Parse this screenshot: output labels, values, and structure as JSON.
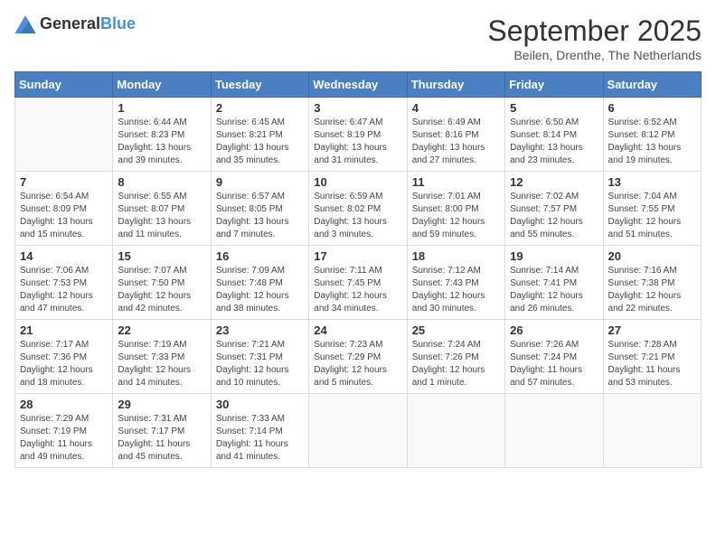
{
  "header": {
    "logo_general": "General",
    "logo_blue": "Blue",
    "month": "September 2025",
    "location": "Beilen, Drenthe, The Netherlands"
  },
  "weekdays": [
    "Sunday",
    "Monday",
    "Tuesday",
    "Wednesday",
    "Thursday",
    "Friday",
    "Saturday"
  ],
  "weeks": [
    [
      {
        "day": "",
        "info": ""
      },
      {
        "day": "1",
        "info": "Sunrise: 6:44 AM\nSunset: 8:23 PM\nDaylight: 13 hours\nand 39 minutes."
      },
      {
        "day": "2",
        "info": "Sunrise: 6:45 AM\nSunset: 8:21 PM\nDaylight: 13 hours\nand 35 minutes."
      },
      {
        "day": "3",
        "info": "Sunrise: 6:47 AM\nSunset: 8:19 PM\nDaylight: 13 hours\nand 31 minutes."
      },
      {
        "day": "4",
        "info": "Sunrise: 6:49 AM\nSunset: 8:16 PM\nDaylight: 13 hours\nand 27 minutes."
      },
      {
        "day": "5",
        "info": "Sunrise: 6:50 AM\nSunset: 8:14 PM\nDaylight: 13 hours\nand 23 minutes."
      },
      {
        "day": "6",
        "info": "Sunrise: 6:52 AM\nSunset: 8:12 PM\nDaylight: 13 hours\nand 19 minutes."
      }
    ],
    [
      {
        "day": "7",
        "info": "Sunrise: 6:54 AM\nSunset: 8:09 PM\nDaylight: 13 hours\nand 15 minutes."
      },
      {
        "day": "8",
        "info": "Sunrise: 6:55 AM\nSunset: 8:07 PM\nDaylight: 13 hours\nand 11 minutes."
      },
      {
        "day": "9",
        "info": "Sunrise: 6:57 AM\nSunset: 8:05 PM\nDaylight: 13 hours\nand 7 minutes."
      },
      {
        "day": "10",
        "info": "Sunrise: 6:59 AM\nSunset: 8:02 PM\nDaylight: 13 hours\nand 3 minutes."
      },
      {
        "day": "11",
        "info": "Sunrise: 7:01 AM\nSunset: 8:00 PM\nDaylight: 12 hours\nand 59 minutes."
      },
      {
        "day": "12",
        "info": "Sunrise: 7:02 AM\nSunset: 7:57 PM\nDaylight: 12 hours\nand 55 minutes."
      },
      {
        "day": "13",
        "info": "Sunrise: 7:04 AM\nSunset: 7:55 PM\nDaylight: 12 hours\nand 51 minutes."
      }
    ],
    [
      {
        "day": "14",
        "info": "Sunrise: 7:06 AM\nSunset: 7:53 PM\nDaylight: 12 hours\nand 47 minutes."
      },
      {
        "day": "15",
        "info": "Sunrise: 7:07 AM\nSunset: 7:50 PM\nDaylight: 12 hours\nand 42 minutes."
      },
      {
        "day": "16",
        "info": "Sunrise: 7:09 AM\nSunset: 7:48 PM\nDaylight: 12 hours\nand 38 minutes."
      },
      {
        "day": "17",
        "info": "Sunrise: 7:11 AM\nSunset: 7:45 PM\nDaylight: 12 hours\nand 34 minutes."
      },
      {
        "day": "18",
        "info": "Sunrise: 7:12 AM\nSunset: 7:43 PM\nDaylight: 12 hours\nand 30 minutes."
      },
      {
        "day": "19",
        "info": "Sunrise: 7:14 AM\nSunset: 7:41 PM\nDaylight: 12 hours\nand 26 minutes."
      },
      {
        "day": "20",
        "info": "Sunrise: 7:16 AM\nSunset: 7:38 PM\nDaylight: 12 hours\nand 22 minutes."
      }
    ],
    [
      {
        "day": "21",
        "info": "Sunrise: 7:17 AM\nSunset: 7:36 PM\nDaylight: 12 hours\nand 18 minutes."
      },
      {
        "day": "22",
        "info": "Sunrise: 7:19 AM\nSunset: 7:33 PM\nDaylight: 12 hours\nand 14 minutes."
      },
      {
        "day": "23",
        "info": "Sunrise: 7:21 AM\nSunset: 7:31 PM\nDaylight: 12 hours\nand 10 minutes."
      },
      {
        "day": "24",
        "info": "Sunrise: 7:23 AM\nSunset: 7:29 PM\nDaylight: 12 hours\nand 5 minutes."
      },
      {
        "day": "25",
        "info": "Sunrise: 7:24 AM\nSunset: 7:26 PM\nDaylight: 12 hours\nand 1 minute."
      },
      {
        "day": "26",
        "info": "Sunrise: 7:26 AM\nSunset: 7:24 PM\nDaylight: 11 hours\nand 57 minutes."
      },
      {
        "day": "27",
        "info": "Sunrise: 7:28 AM\nSunset: 7:21 PM\nDaylight: 11 hours\nand 53 minutes."
      }
    ],
    [
      {
        "day": "28",
        "info": "Sunrise: 7:29 AM\nSunset: 7:19 PM\nDaylight: 11 hours\nand 49 minutes."
      },
      {
        "day": "29",
        "info": "Sunrise: 7:31 AM\nSunset: 7:17 PM\nDaylight: 11 hours\nand 45 minutes."
      },
      {
        "day": "30",
        "info": "Sunrise: 7:33 AM\nSunset: 7:14 PM\nDaylight: 11 hours\nand 41 minutes."
      },
      {
        "day": "",
        "info": ""
      },
      {
        "day": "",
        "info": ""
      },
      {
        "day": "",
        "info": ""
      },
      {
        "day": "",
        "info": ""
      }
    ]
  ]
}
